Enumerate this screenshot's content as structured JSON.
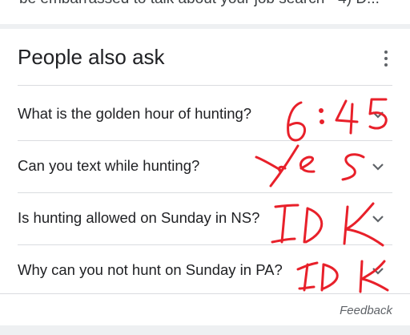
{
  "top_snippet": {
    "text": "be embarrassed to talk about your job search - 4) D..."
  },
  "people_also_ask": {
    "title": "People also ask",
    "menu_icon": "more-vert-icon",
    "questions": [
      {
        "text": "What is the golden hour of hunting?",
        "icon": "chevron-down-icon"
      },
      {
        "text": "Can you text while hunting?",
        "icon": "chevron-down-icon"
      },
      {
        "text": "Is hunting allowed on Sunday in NS?",
        "icon": "chevron-down-icon"
      },
      {
        "text": "Why can you not hunt on Sunday in PA?",
        "icon": "chevron-down-icon"
      }
    ],
    "feedback_label": "Feedback"
  },
  "handwritten_annotations": {
    "color": "#e8202a",
    "items": [
      "6:45",
      "Yes",
      "IDK",
      "IDK"
    ]
  }
}
